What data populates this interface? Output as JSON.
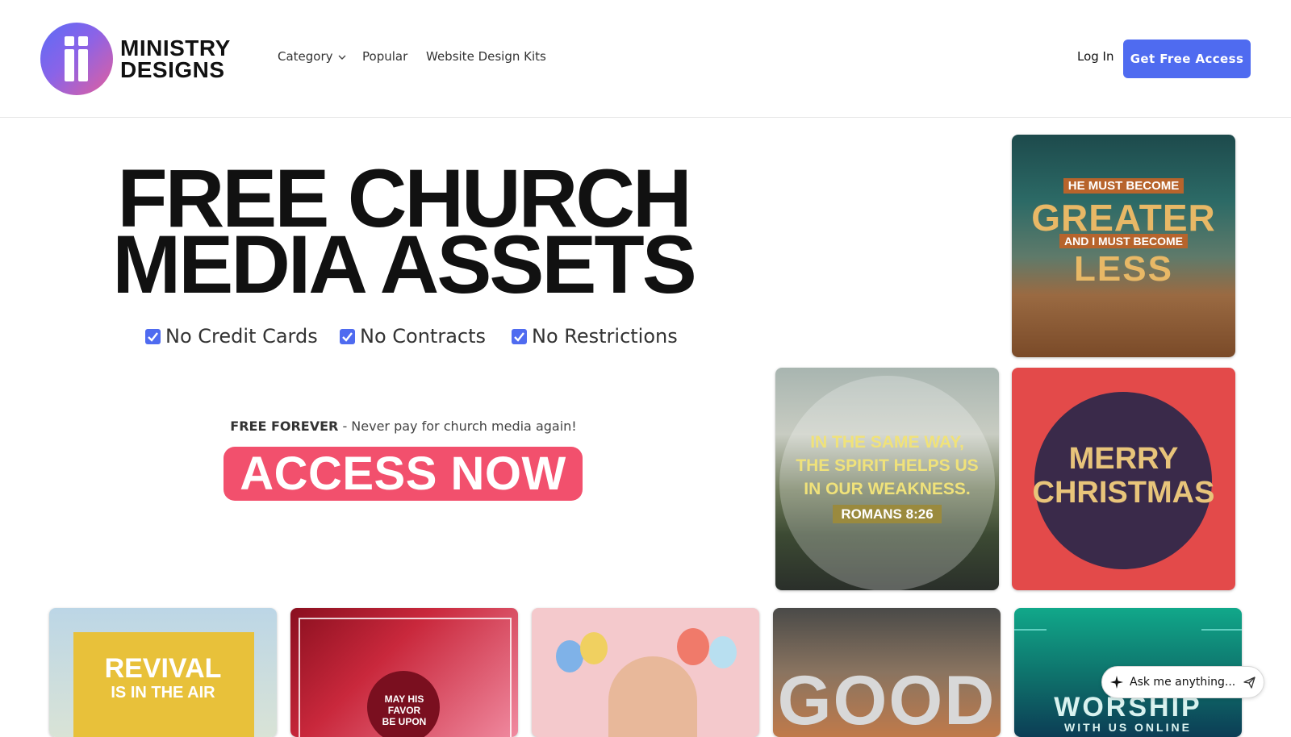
{
  "brand": {
    "line1": "MINISTRY",
    "line2": "DESIGNS"
  },
  "nav": {
    "category": "Category",
    "popular": "Popular",
    "kits": "Website Design Kits"
  },
  "header": {
    "login": "Log In",
    "cta": "Get Free Access"
  },
  "hero": {
    "title_line1": "FREE CHURCH",
    "title_line2": "MEDIA ASSETS",
    "checks": [
      "No Credit Cards",
      "No Contracts",
      "No Restrictions"
    ],
    "tagline_bold": "FREE FOREVER",
    "tagline_rest": " - Never pay for church media again!",
    "cta": "ACCESS NOW"
  },
  "tiles": {
    "greater": {
      "top": "HE MUST BECOME",
      "big1": "GREATER",
      "mid": "AND I MUST BECOME",
      "big2": "LESS"
    },
    "spirit": {
      "l1": "IN THE SAME WAY,",
      "l2": "THE SPIRIT HELPS US",
      "l3": "IN OUR WEAKNESS.",
      "ref": "ROMANS 8:26"
    },
    "christmas": {
      "l1": "MERRY",
      "l2": "CHRISTMAS"
    },
    "revival": {
      "l1": "REVIVAL",
      "l2": "IS IN THE AIR"
    },
    "favor": {
      "l1": "MAY HIS",
      "l2": "FAVOR",
      "l3": "BE UPON"
    },
    "good": {
      "l1": "GOOD"
    },
    "worship": {
      "l1": "WORSHIP",
      "l2": "WITH US ONLINE"
    }
  },
  "chat": {
    "placeholder": "Ask me anything..."
  },
  "colors": {
    "accent": "#4f6bf0",
    "cta": "#f2506d"
  }
}
